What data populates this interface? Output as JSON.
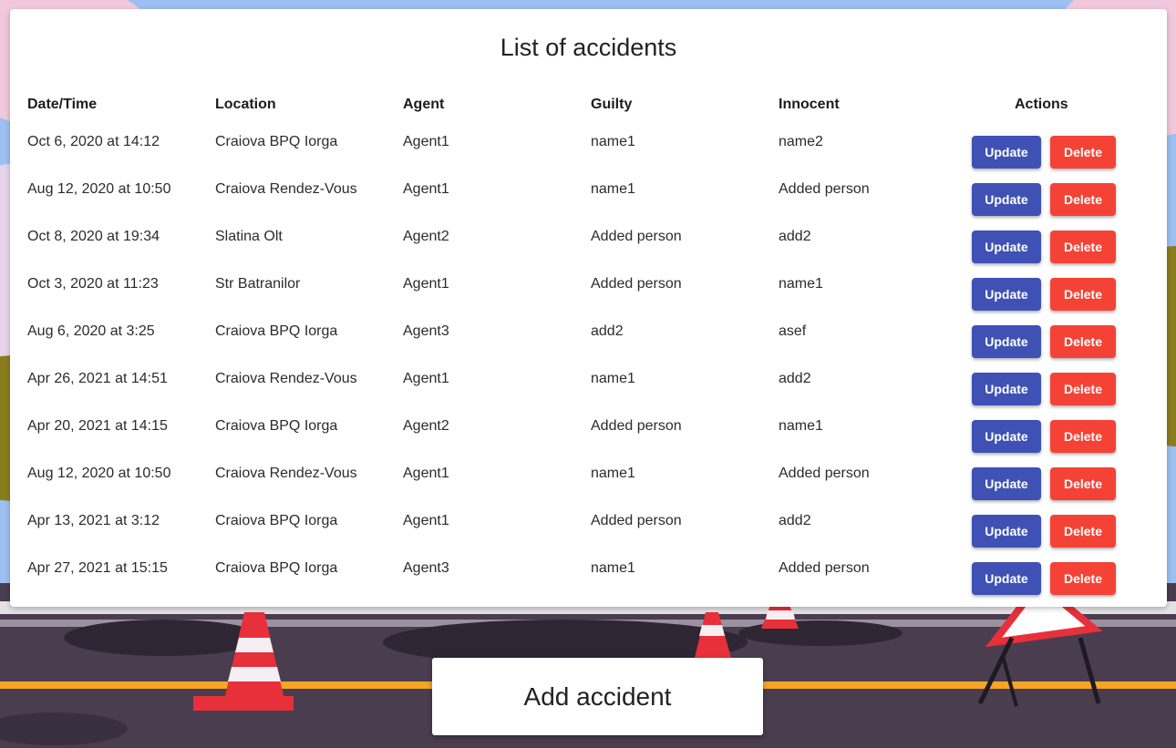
{
  "page": {
    "title": "List of accidents"
  },
  "table": {
    "headers": {
      "datetime": "Date/Time",
      "location": "Location",
      "agent": "Agent",
      "guilty": "Guilty",
      "innocent": "Innocent",
      "actions": "Actions"
    },
    "rows": [
      {
        "datetime": "Oct 6, 2020 at 14:12",
        "location": "Craiova BPQ Iorga",
        "agent": "Agent1",
        "guilty": "name1",
        "innocent": "name2"
      },
      {
        "datetime": "Aug 12, 2020 at 10:50",
        "location": "Craiova Rendez-Vous",
        "agent": "Agent1",
        "guilty": "name1",
        "innocent": "Added person"
      },
      {
        "datetime": "Oct 8, 2020 at 19:34",
        "location": "Slatina Olt",
        "agent": "Agent2",
        "guilty": "Added person",
        "innocent": "add2"
      },
      {
        "datetime": "Oct 3, 2020 at 11:23",
        "location": "Str Batranilor",
        "agent": "Agent1",
        "guilty": "Added person",
        "innocent": "name1"
      },
      {
        "datetime": "Aug 6, 2020 at 3:25",
        "location": "Craiova BPQ Iorga",
        "agent": "Agent3",
        "guilty": "add2",
        "innocent": "asef"
      },
      {
        "datetime": "Apr 26, 2021 at 14:51",
        "location": "Craiova Rendez-Vous",
        "agent": "Agent1",
        "guilty": "name1",
        "innocent": "add2"
      },
      {
        "datetime": "Apr 20, 2021 at 14:15",
        "location": "Craiova BPQ Iorga",
        "agent": "Agent2",
        "guilty": "Added person",
        "innocent": "name1"
      },
      {
        "datetime": "Aug 12, 2020 at 10:50",
        "location": "Craiova Rendez-Vous",
        "agent": "Agent1",
        "guilty": "name1",
        "innocent": "Added person"
      },
      {
        "datetime": "Apr 13, 2021 at 3:12",
        "location": "Craiova BPQ Iorga",
        "agent": "Agent1",
        "guilty": "Added person",
        "innocent": "add2"
      },
      {
        "datetime": "Apr 27, 2021 at 15:15",
        "location": "Craiova BPQ Iorga",
        "agent": "Agent3",
        "guilty": "name1",
        "innocent": "Added person"
      }
    ],
    "update_label": "Update",
    "delete_label": "Delete"
  },
  "add_button": {
    "label": "Add accident"
  },
  "colors": {
    "update": "#3f51b5",
    "delete": "#f44336",
    "sky": "#8fb7f0",
    "road": "#4a3d4f",
    "road_line": "#f6a623",
    "cone": "#e8303a"
  }
}
